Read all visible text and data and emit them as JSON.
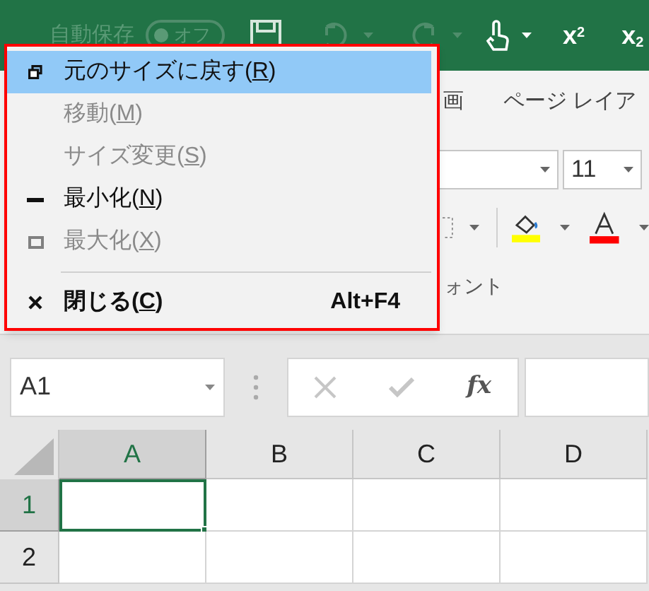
{
  "title_bar": {
    "autosave_label": "自動保存",
    "autosave_toggle": {
      "label": "オフ",
      "on": false
    },
    "superscript": {
      "base": "x",
      "mark": "2"
    },
    "subscript": {
      "base": "x",
      "mark": "2"
    }
  },
  "ribbon": {
    "tabs": [
      "画",
      "ページ レイア"
    ],
    "font_size": "11",
    "group_label": "ォント"
  },
  "formula_bar": {
    "name_box": "A1",
    "fx": "fx"
  },
  "sheet": {
    "columns": [
      {
        "label": "A",
        "selected": true
      },
      {
        "label": "B",
        "selected": false
      },
      {
        "label": "C",
        "selected": false
      },
      {
        "label": "D",
        "selected": false
      }
    ],
    "rows": [
      {
        "label": "1",
        "selected": true
      },
      {
        "label": "2",
        "selected": false
      }
    ]
  },
  "system_menu": {
    "items": [
      {
        "kind": "restore",
        "label": "元のサイズに戻す(",
        "access_key": "R",
        "label_end": ")",
        "selected": true,
        "disabled": false
      },
      {
        "kind": "move",
        "label": "移動(",
        "access_key": "M",
        "label_end": ")",
        "selected": false,
        "disabled": true
      },
      {
        "kind": "size",
        "label": "サイズ変更(",
        "access_key": "S",
        "label_end": ")",
        "selected": false,
        "disabled": true
      },
      {
        "kind": "minimize",
        "label": "最小化(",
        "access_key": "N",
        "label_end": ")",
        "selected": false,
        "disabled": false
      },
      {
        "kind": "maximize",
        "label": "最大化(",
        "access_key": "X",
        "label_end": ")",
        "selected": false,
        "disabled": true
      },
      {
        "kind": "separator"
      },
      {
        "kind": "close",
        "label": "閉じる(",
        "access_key": "C",
        "label_end": ")",
        "shortcut": "Alt+F4",
        "selected": false,
        "disabled": false
      }
    ]
  }
}
